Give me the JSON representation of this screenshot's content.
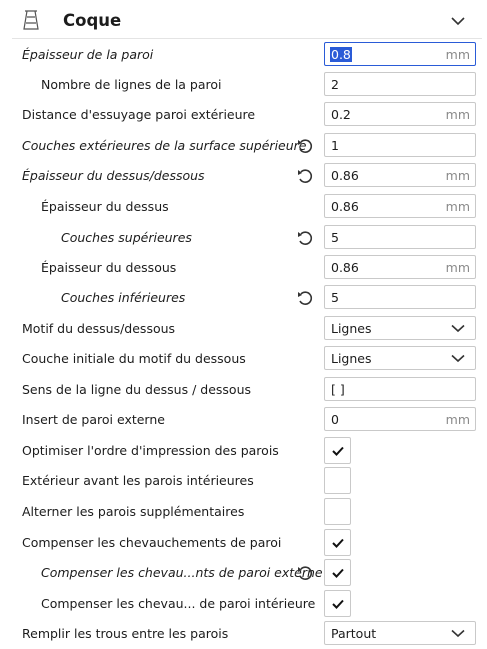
{
  "section": {
    "title": "Coque",
    "icon": "shell-icon",
    "collapse_icon": "chevron-down-icon"
  },
  "settings": [
    {
      "label": "Épaisseur de la paroi",
      "italic": true,
      "value": "0.8",
      "unit": "mm",
      "type": "number",
      "selected": true
    },
    {
      "label": "Nombre de lignes de la paroi",
      "value": "2",
      "type": "number"
    },
    {
      "label": "Distance d'essuyage paroi extérieure",
      "value": "0.2",
      "unit": "mm",
      "type": "number"
    },
    {
      "label": "Couches extérieures de la surface supérieure",
      "italic": true,
      "reset": true,
      "value": "1",
      "type": "number"
    },
    {
      "label": "Épaisseur du dessus/dessous",
      "italic": true,
      "reset": true,
      "value": "0.86",
      "unit": "mm",
      "type": "number"
    },
    {
      "label": "Épaisseur du dessus",
      "value": "0.86",
      "unit": "mm",
      "type": "number"
    },
    {
      "label": "Couches supérieures",
      "italic": true,
      "reset": true,
      "value": "5",
      "type": "number"
    },
    {
      "label": "Épaisseur du dessous",
      "value": "0.86",
      "unit": "mm",
      "type": "number"
    },
    {
      "label": "Couches inférieures",
      "italic": true,
      "reset": true,
      "value": "5",
      "type": "number"
    },
    {
      "label": "Motif du dessus/dessous",
      "value": "Lignes",
      "type": "dropdown"
    },
    {
      "label": "Couche initiale du motif du dessous",
      "value": "Lignes",
      "type": "dropdown"
    },
    {
      "label": "Sens de la ligne du dessus / dessous",
      "value": "[ ]",
      "type": "text"
    },
    {
      "label": "Insert de paroi externe",
      "value": "0",
      "unit": "mm",
      "type": "number"
    },
    {
      "label": "Optimiser l'ordre d'impression des parois",
      "checked": true,
      "type": "checkbox"
    },
    {
      "label": "Extérieur avant les parois intérieures",
      "checked": false,
      "type": "checkbox"
    },
    {
      "label": "Alterner les parois supplémentaires",
      "checked": false,
      "type": "checkbox"
    },
    {
      "label": "Compenser les chevauchements de paroi",
      "checked": true,
      "type": "checkbox"
    },
    {
      "label": "Compenser les chevau...nts de paroi externe",
      "italic": true,
      "reset": true,
      "checked": true,
      "type": "checkbox"
    },
    {
      "label": "Compenser les chevau... de paroi intérieure",
      "checked": true,
      "type": "checkbox"
    },
    {
      "label": "Remplir les trous entre les parois",
      "value": "Partout",
      "type": "dropdown"
    }
  ],
  "colors": {
    "accent": "#2a5bd7",
    "text": "#1c1c1c",
    "unit": "#8a8a8a",
    "border": "#c9c9c9"
  }
}
